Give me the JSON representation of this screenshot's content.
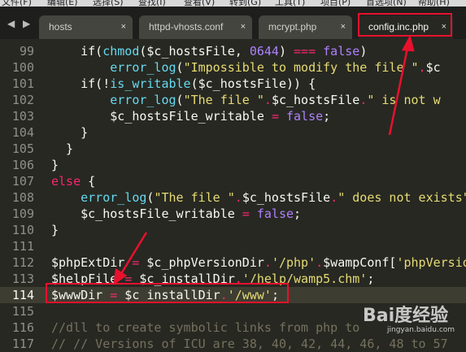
{
  "menu": {
    "items": [
      "文件(F)",
      "编辑(E)",
      "选择(S)",
      "查找(I)",
      "查看(V)",
      "转到(G)",
      "工具(T)",
      "项目(P)",
      "首选项(N)",
      "帮助(H)"
    ]
  },
  "tabs": [
    {
      "label": "hosts",
      "close": "×"
    },
    {
      "label": "httpd-vhosts.conf",
      "close": "×"
    },
    {
      "label": "mcrypt.php",
      "close": "×"
    },
    {
      "label": "config.inc.php",
      "close": "×"
    }
  ],
  "nav": {
    "back": "◀",
    "forward": "▶"
  },
  "editor": {
    "current_line": 114,
    "lines": [
      {
        "num": "99",
        "code": [
          [
            "    if(",
            "v"
          ],
          [
            "chmod",
            "f"
          ],
          [
            "($c_hostsFile, ",
            "v"
          ],
          [
            "0644",
            "n"
          ],
          [
            ") ",
            "v"
          ],
          [
            "===",
            "o"
          ],
          [
            " ",
            "v"
          ],
          [
            "false",
            "n"
          ],
          [
            ")",
            "v"
          ]
        ]
      },
      {
        "num": "100",
        "code": [
          [
            "        ",
            "v"
          ],
          [
            "error_log",
            "f"
          ],
          [
            "(",
            "v"
          ],
          [
            "\"Impossible to modify the file \"",
            "s"
          ],
          [
            ".",
            "o"
          ],
          [
            "$c",
            "v"
          ]
        ]
      },
      {
        "num": "101",
        "code": [
          [
            "    if(!",
            "v"
          ],
          [
            "is_writable",
            "f"
          ],
          [
            "($c_hostsFile)) {",
            "v"
          ]
        ]
      },
      {
        "num": "102",
        "code": [
          [
            "        ",
            "v"
          ],
          [
            "error_log",
            "f"
          ],
          [
            "(",
            "v"
          ],
          [
            "\"The file \"",
            "s"
          ],
          [
            ".",
            "o"
          ],
          [
            "$c_hostsFile",
            "v"
          ],
          [
            ".",
            "o"
          ],
          [
            "\" is not w",
            "s"
          ]
        ]
      },
      {
        "num": "103",
        "code": [
          [
            "        $c_hostsFile_writable ",
            "v"
          ],
          [
            "=",
            "o"
          ],
          [
            " ",
            "v"
          ],
          [
            "false",
            "n"
          ],
          [
            ";",
            "v"
          ]
        ]
      },
      {
        "num": "104",
        "code": [
          [
            "    }",
            "v"
          ]
        ]
      },
      {
        "num": "105",
        "code": [
          [
            "  }",
            "v"
          ]
        ]
      },
      {
        "num": "106",
        "code": [
          [
            "}",
            "v"
          ]
        ]
      },
      {
        "num": "107",
        "code": [
          [
            "else",
            "k"
          ],
          [
            " {",
            "v"
          ]
        ]
      },
      {
        "num": "108",
        "code": [
          [
            "    ",
            "v"
          ],
          [
            "error_log",
            "f"
          ],
          [
            "(",
            "v"
          ],
          [
            "\"The file \"",
            "s"
          ],
          [
            ".",
            "o"
          ],
          [
            "$c_hostsFile",
            "v"
          ],
          [
            ".",
            "o"
          ],
          [
            "\" does not exists\"",
            "s"
          ],
          [
            ")",
            "v"
          ]
        ]
      },
      {
        "num": "109",
        "code": [
          [
            "    $c_hostsFile_writable ",
            "v"
          ],
          [
            "=",
            "o"
          ],
          [
            " ",
            "v"
          ],
          [
            "false",
            "n"
          ],
          [
            ";",
            "v"
          ]
        ]
      },
      {
        "num": "110",
        "code": [
          [
            "}",
            "v"
          ]
        ]
      },
      {
        "num": "111",
        "code": []
      },
      {
        "num": "112",
        "code": [
          [
            "$phpExtDir ",
            "v"
          ],
          [
            "=",
            "o"
          ],
          [
            " $c_phpVersionDir",
            "v"
          ],
          [
            ".",
            "o"
          ],
          [
            "'/php'",
            "s"
          ],
          [
            ".",
            "o"
          ],
          [
            "$wampConf[",
            "v"
          ],
          [
            "'phpVersio",
            "s"
          ]
        ]
      },
      {
        "num": "113",
        "code": [
          [
            "$helpFile ",
            "v"
          ],
          [
            "=",
            "o"
          ],
          [
            " $c_installDir",
            "v"
          ],
          [
            ".",
            "o"
          ],
          [
            "'/help/wamp5.chm'",
            "s"
          ],
          [
            ";",
            "v"
          ]
        ]
      },
      {
        "num": "114",
        "code": [
          [
            "$wwwDir ",
            "v"
          ],
          [
            "=",
            "o"
          ],
          [
            " $c_installDir",
            "v"
          ],
          [
            ".",
            "o"
          ],
          [
            "'/www'",
            "s"
          ],
          [
            ";",
            "v"
          ]
        ]
      },
      {
        "num": "115",
        "code": []
      },
      {
        "num": "116",
        "code": [
          [
            "//dll to create symbolic links from php to",
            "c"
          ]
        ]
      },
      {
        "num": "117",
        "code": [
          [
            "// // Versions of ICU are 38, 40, 42, 44, 46, 48 to 57",
            "c"
          ]
        ]
      }
    ]
  },
  "annotation_color": "#e8112d",
  "watermark": {
    "main": "Bai度经验",
    "sub": "jingyan.baidu.com"
  }
}
